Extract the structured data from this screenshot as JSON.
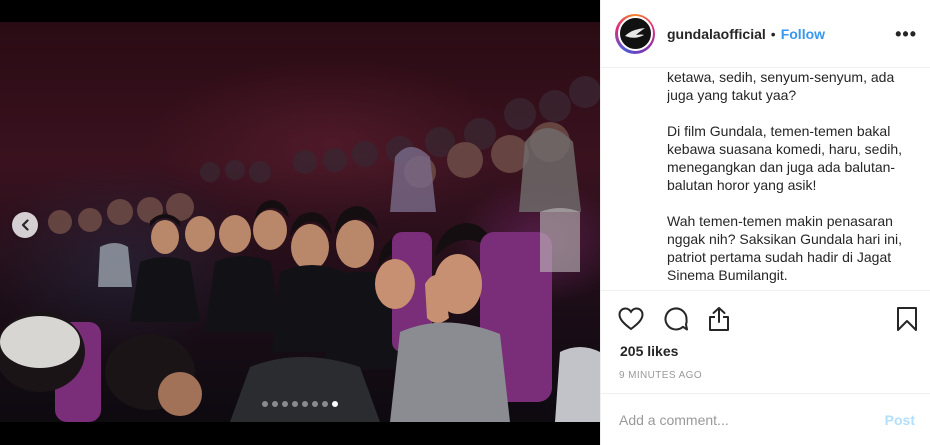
{
  "post": {
    "username": "gundalaofficial",
    "separator": "•",
    "follow_label": "Follow",
    "more_label": "•••",
    "caption": {
      "paragraph1": "ketawa, sedih, senyum-senyum, ada juga yang takut yaa?",
      "paragraph2": "Di film Gundala, temen-temen bakal kebawa suasana komedi, haru, sedih, menegangkan dan juga ada balutan-balutan horor yang asik!",
      "paragraph3": "Wah temen-temen makin penasaran nggak nih? Saksikan Gundala hari ini, patriot pertama sudah hadir di Jagat Sinema Bumilangit."
    },
    "likes": "205 likes",
    "timestamp": "9 MINUTES AGO"
  },
  "actions": {
    "like_icon": "heart-icon",
    "comment_icon": "comment-icon",
    "share_icon": "share-icon",
    "save_icon": "bookmark-icon"
  },
  "comment": {
    "placeholder": "Add a comment...",
    "post_label": "Post"
  },
  "carousel": {
    "total": 8,
    "active_index": 7
  },
  "colors": {
    "link_blue": "#3897f0",
    "post_disabled": "#b2dffc",
    "muted_text": "#999999",
    "border": "#efefef"
  }
}
